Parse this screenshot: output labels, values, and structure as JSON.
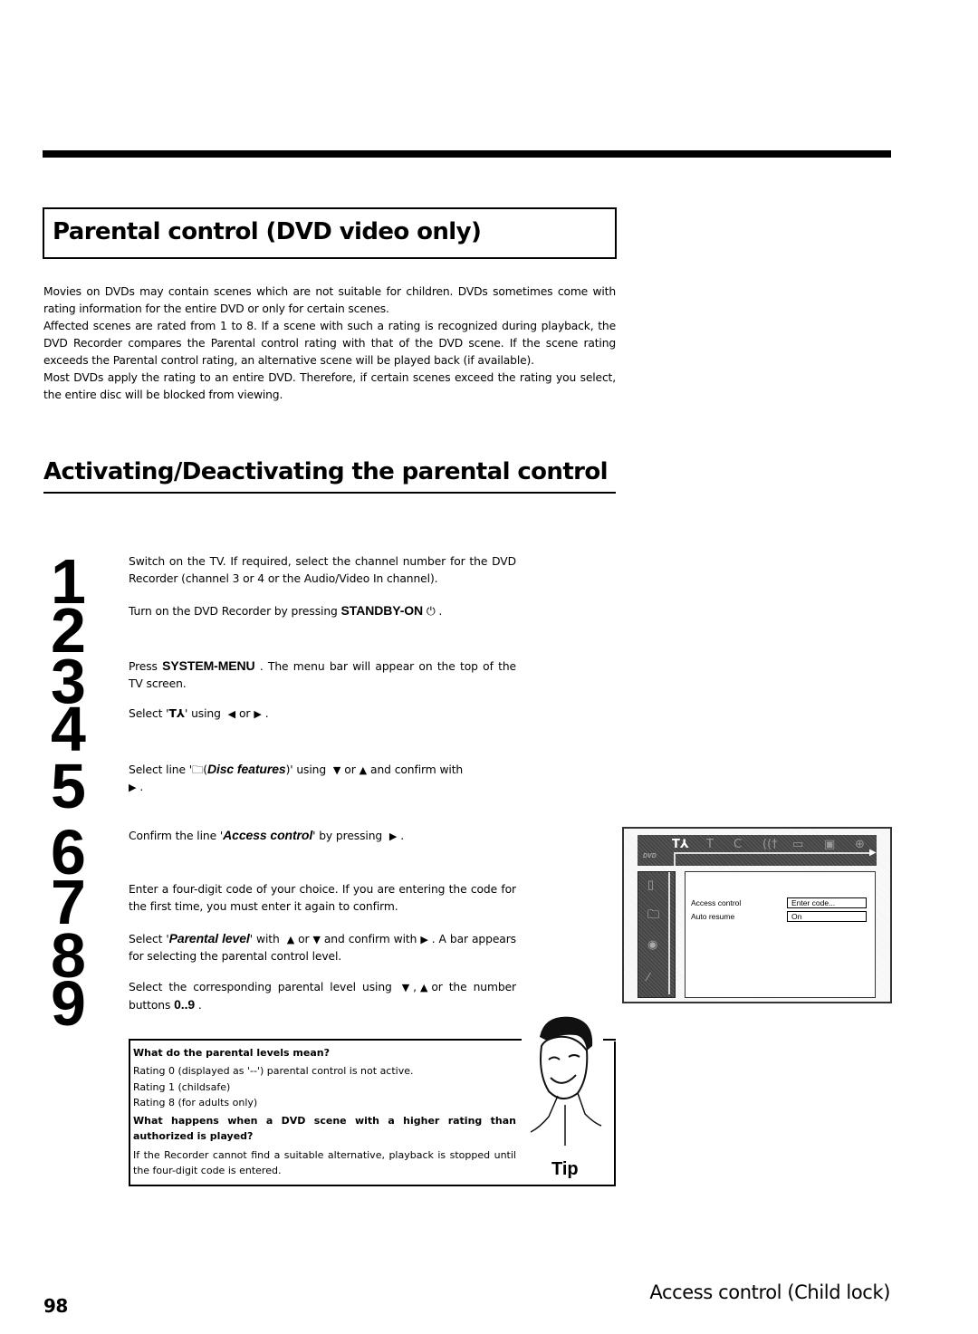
{
  "title": "Parental control (DVD video only)",
  "intro": [
    "Movies on DVDs may contain scenes which are not suitable for children. DVDs sometimes come with rating information for the entire DVD or only for certain scenes.",
    "Affected scenes are rated from 1 to 8. If a scene with such a rating is recognized during playback, the DVD Recorder compares the Parental control rating with that of the DVD scene. If the scene rating exceeds the Parental control rating, an alternative scene will be played back (if available).",
    "Most DVDs apply the rating to an entire DVD. Therefore, if certain scenes exceed the rating you select, the entire disc will be blocked from viewing."
  ],
  "section_heading": "Activating/Deactivating the parental control",
  "steps": [
    {
      "num": "1",
      "text": "Switch on the TV. If required, select the channel number for the DVD Recorder (channel 3 or 4 or the Audio/Video In channel)."
    },
    {
      "num": "2",
      "pre": "Turn on the DVD Recorder by pressing ",
      "key": "STANDBY-ON",
      "icon": "power-icon",
      "post": " ."
    },
    {
      "num": "3",
      "pre": "Press ",
      "key": "SYSTEM-MENU",
      "post": " . The menu bar will appear on the top of the TV screen."
    },
    {
      "num": "4",
      "pre": "Select '",
      "icon": "settings-tools-icon",
      "mid": "' using",
      "post": "."
    },
    {
      "num": "5",
      "pre": "Select line '",
      "icon": "disc-features-icon",
      "em": "Disc features",
      "mid": ")' using",
      "post": "and confirm with"
    },
    {
      "num": "6",
      "pre": "Confirm the line '",
      "em": "Access control",
      "post": "' by pressing"
    },
    {
      "num": "7",
      "text": "Enter a four-digit code of your choice. If you are entering the code for the first time, you must enter it again to confirm."
    },
    {
      "num": "8",
      "pre": "Select '",
      "em": "Parental level",
      "mid": "' with",
      "post": ". A bar appears for selecting the parental control level."
    },
    {
      "num": "9",
      "pre": "Select the corresponding parental level using",
      "post": "or the number buttons",
      "key": "0..9"
    }
  ],
  "tip": {
    "q1": "What do the parental levels mean?",
    "ratings": [
      "Rating 0 (displayed as '--') parental control is not active.",
      "Rating 1 (childsafe)",
      "Rating 8 (for adults only)"
    ],
    "q2": "What happens when a DVD scene with a higher rating than authorized is played?",
    "a2": "If the Recorder cannot find a suitable alternative, playback is stopped until the four-digit code is entered.",
    "label": "Tip"
  },
  "screen": {
    "menubar_icons": [
      "settings-icon",
      "title-icon",
      "chapter-icon",
      "audio-icon",
      "subtitle-icon",
      "camera-angle-icon",
      "zoom-icon"
    ],
    "logo": "DVD",
    "rows": [
      {
        "label": "Access control",
        "value": "Enter code..."
      },
      {
        "label": "Auto resume",
        "value": "On"
      }
    ]
  },
  "footer": {
    "page_number": "98",
    "section_name": "Access control (Child lock)"
  }
}
